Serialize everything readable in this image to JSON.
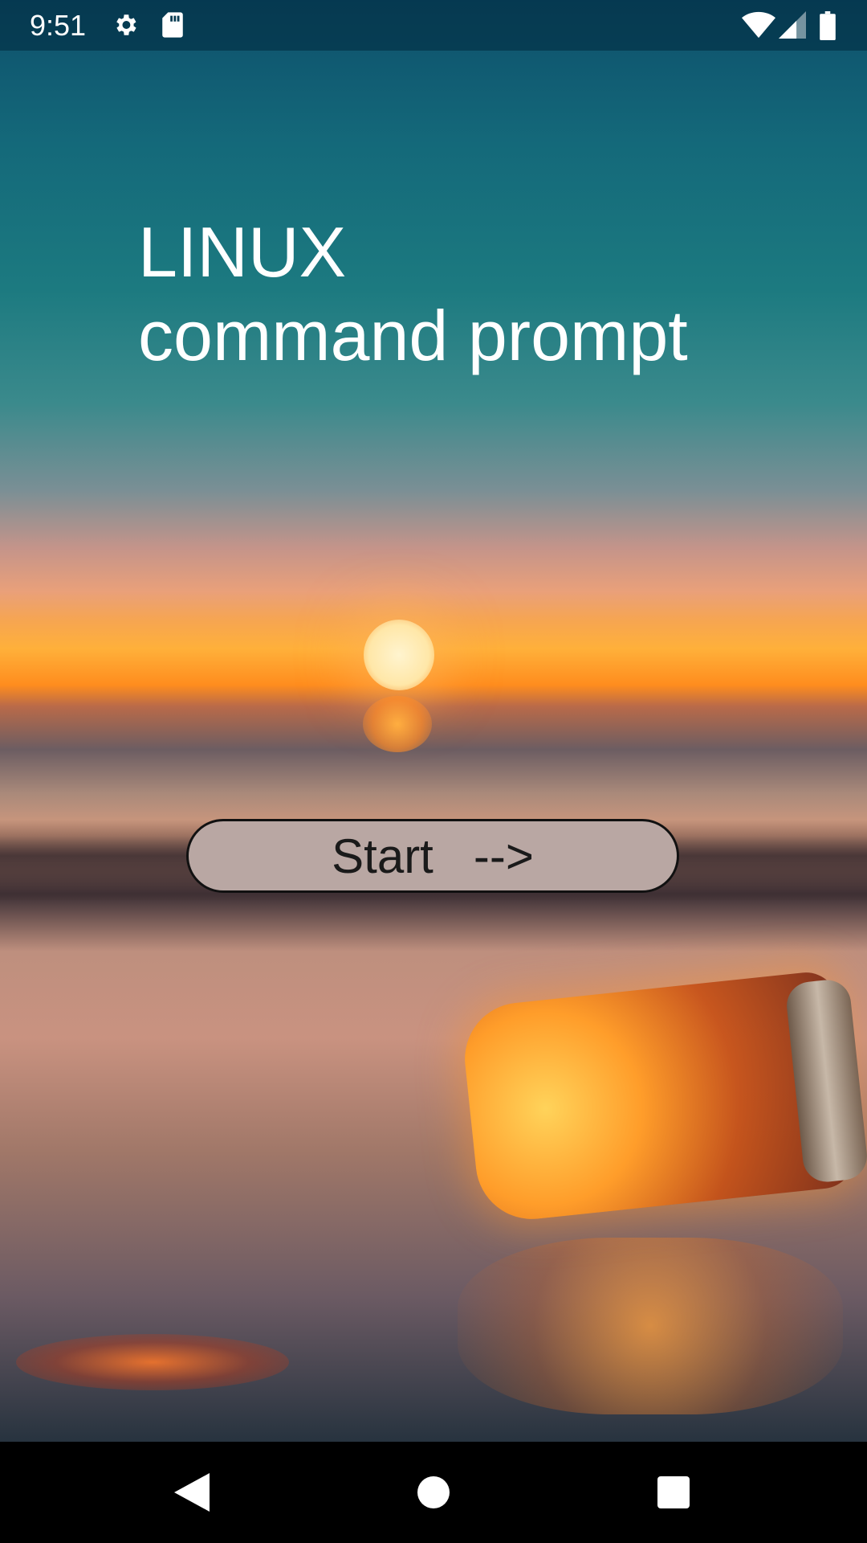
{
  "status_bar": {
    "time": "9:51",
    "icons": [
      "gear-icon",
      "sd-card-icon",
      "wifi-icon",
      "cell-signal-icon",
      "battery-icon"
    ]
  },
  "title": {
    "line1": "LINUX",
    "line2": "command prompt"
  },
  "start_button": {
    "label": "Start   -->"
  },
  "nav_bar": {
    "buttons": [
      "back-icon",
      "home-icon",
      "recents-icon"
    ]
  },
  "colors": {
    "button_bg": "#b9a7a3",
    "title_text": "#ffffff",
    "nav_bg": "#000000"
  }
}
